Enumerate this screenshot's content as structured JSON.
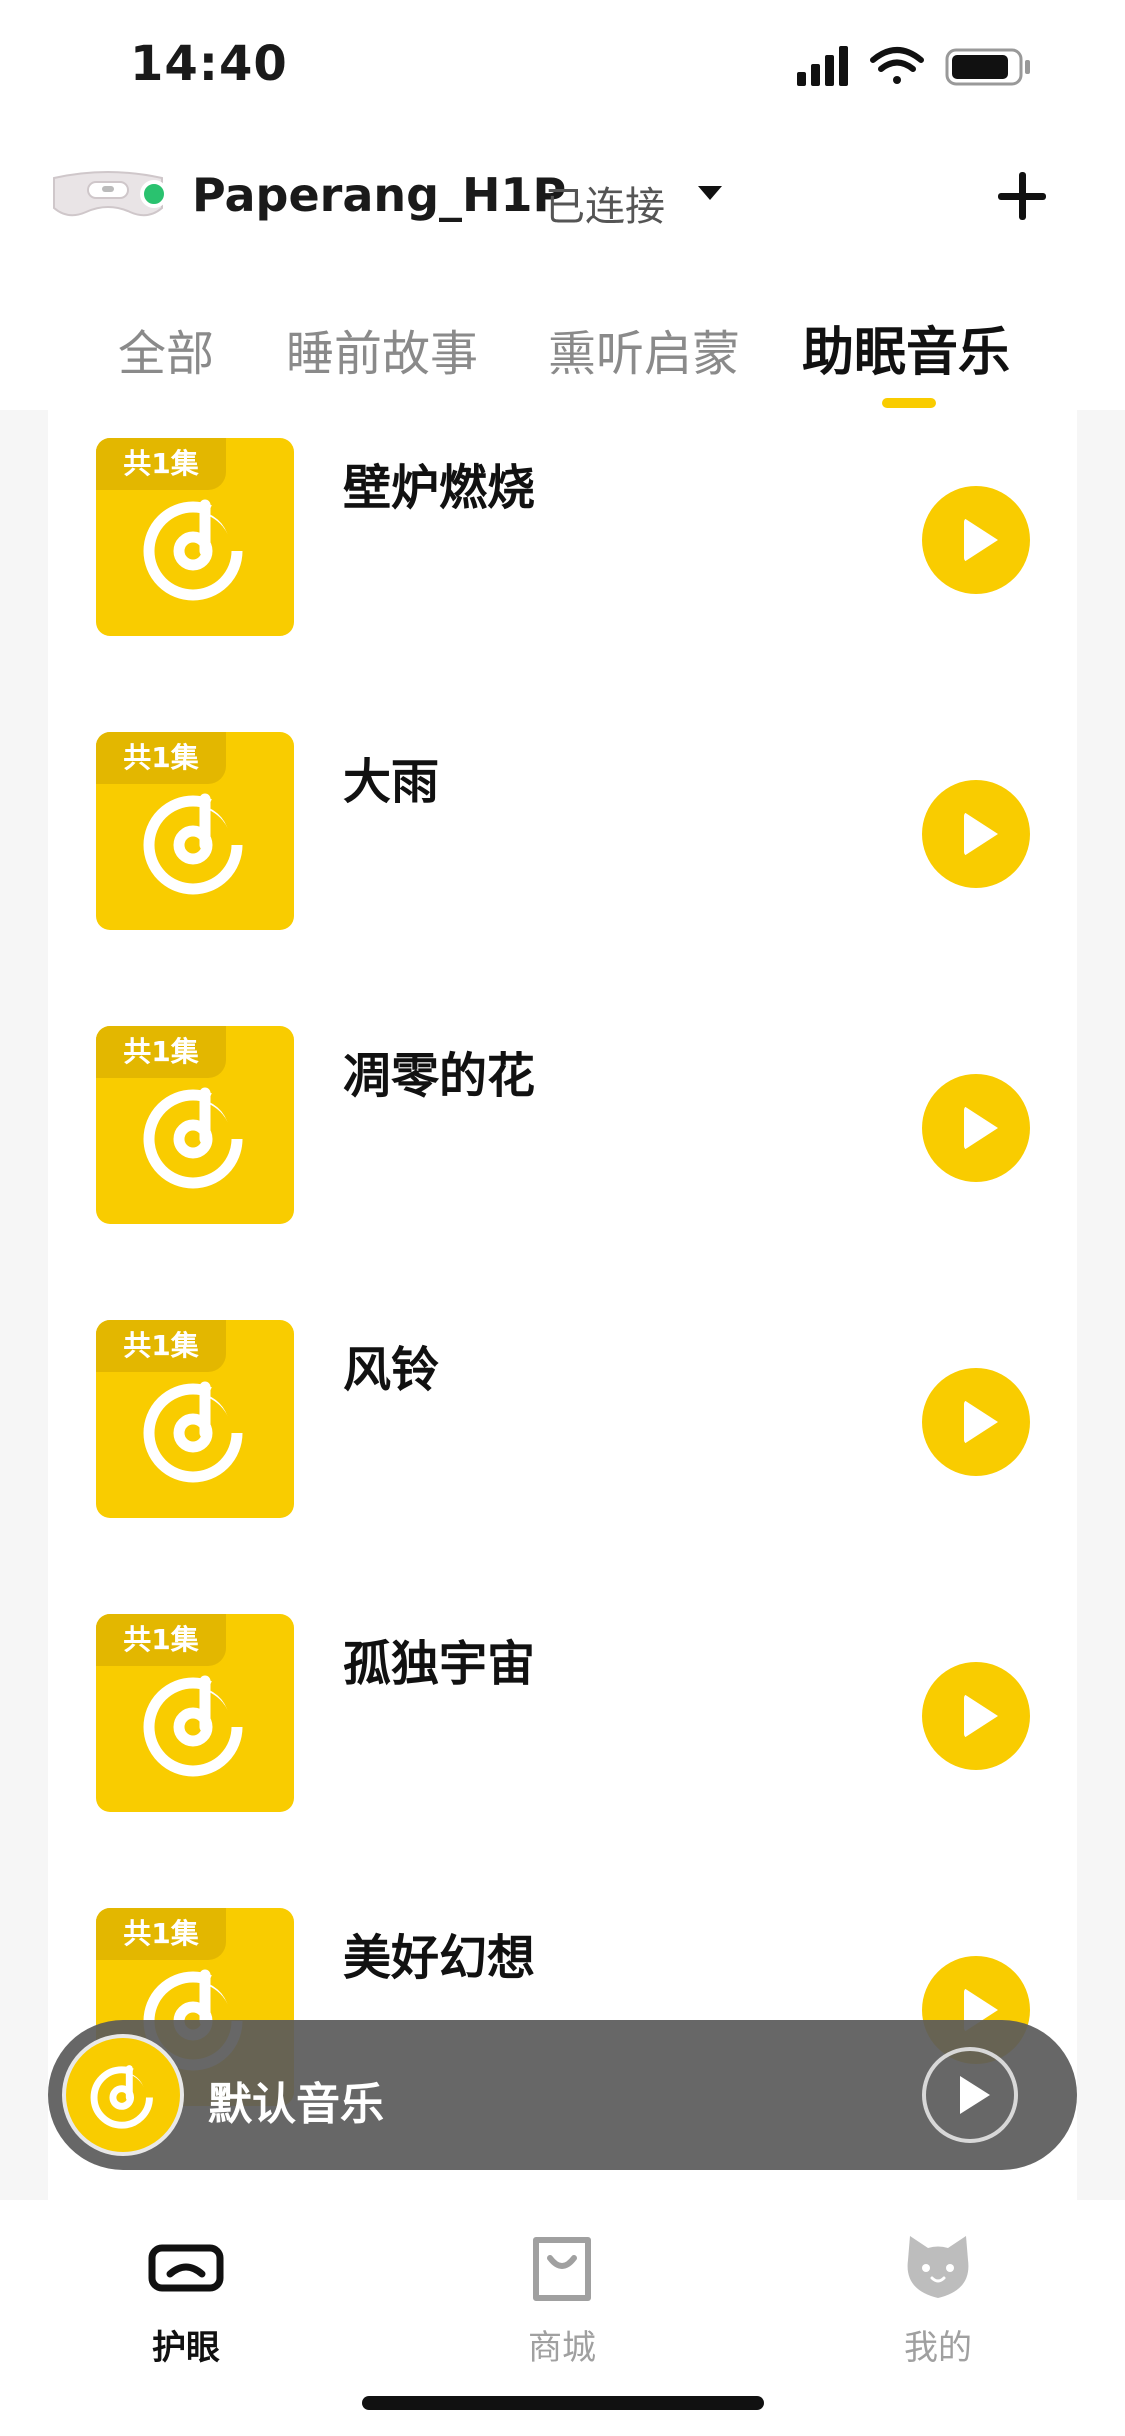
{
  "status_bar": {
    "time": "14:40"
  },
  "header": {
    "device_name": "Paperang_H1P",
    "connection_status": "已连接"
  },
  "tabs": [
    {
      "label": "全部",
      "active": false
    },
    {
      "label": "睡前故事",
      "active": false
    },
    {
      "label": "熏听启蒙",
      "active": false
    },
    {
      "label": "助眠音乐",
      "active": true
    }
  ],
  "list": [
    {
      "title": "壁炉燃烧",
      "episodes": "共1集"
    },
    {
      "title": "大雨",
      "episodes": "共1集"
    },
    {
      "title": "凋零的花",
      "episodes": "共1集"
    },
    {
      "title": "风铃",
      "episodes": "共1集"
    },
    {
      "title": "孤独宇宙",
      "episodes": "共1集"
    },
    {
      "title": "美好幻想",
      "episodes": "共1集"
    }
  ],
  "mini_player": {
    "title": "默认音乐"
  },
  "bottom_nav": [
    {
      "label": "护眼",
      "icon": "eye-mask-icon",
      "active": true
    },
    {
      "label": "商城",
      "icon": "shopping-bag-icon",
      "active": false
    },
    {
      "label": "我的",
      "icon": "cat-face-icon",
      "active": false
    }
  ],
  "colors": {
    "accent": "#f9cc00",
    "online": "#2ac26f",
    "background": "#f6f6f6"
  }
}
